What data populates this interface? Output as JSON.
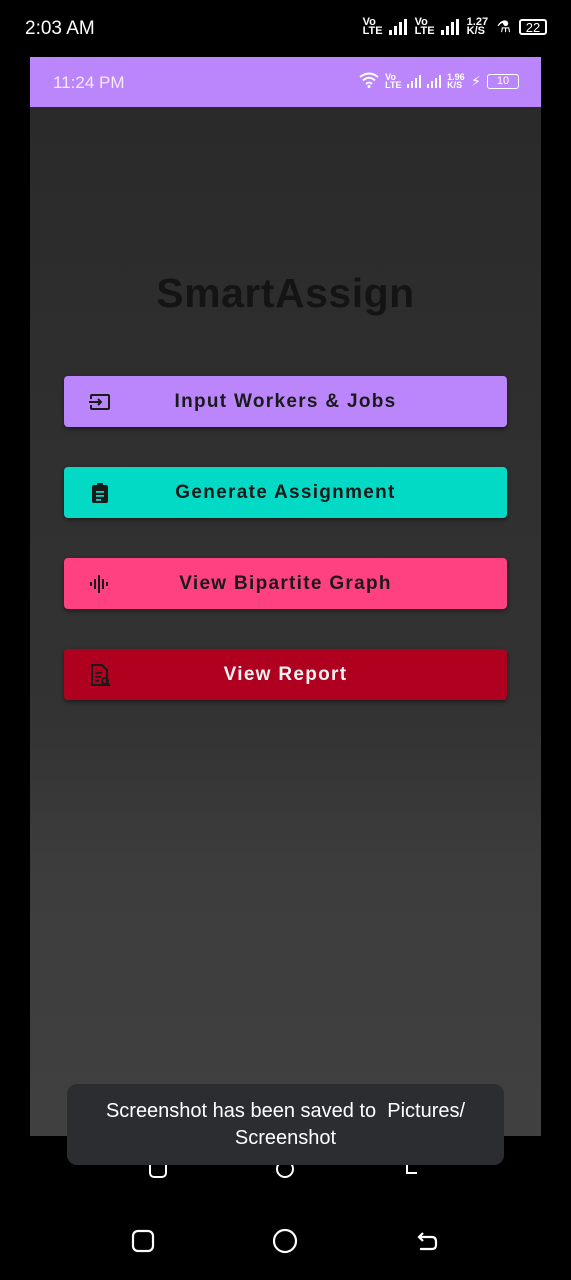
{
  "outer_status": {
    "time": "2:03 AM",
    "sim1": "Vo LTE",
    "net1": "LTE",
    "sim2": "Vo LTE",
    "net2": "LTE",
    "speed": "1.27 K/S",
    "battery": "22"
  },
  "inner_status": {
    "time": "11:24 PM",
    "sim": "Vo LTE",
    "net1": "LTE",
    "net2": "LTE",
    "speed": "1.96 K/S",
    "battery": "10",
    "bar_color": "#bb86fc"
  },
  "app": {
    "title": "SmartAssign",
    "buttons": [
      {
        "label": "Input Workers & Jobs",
        "icon": "input-icon",
        "color": "#bb86fc"
      },
      {
        "label": "Generate Assignment",
        "icon": "clipboard-icon",
        "color": "#03dac5"
      },
      {
        "label": "View Bipartite Graph",
        "icon": "graph-icon",
        "color": "#ff4081"
      },
      {
        "label": "View Report",
        "icon": "report-icon",
        "color": "#b00020"
      }
    ]
  },
  "toast": {
    "line1": "Screenshot has been saved to  Pictures/",
    "line2": "Screenshot"
  },
  "nav": {
    "recent": "square-icon",
    "home": "circle-icon",
    "back": "back-icon"
  }
}
